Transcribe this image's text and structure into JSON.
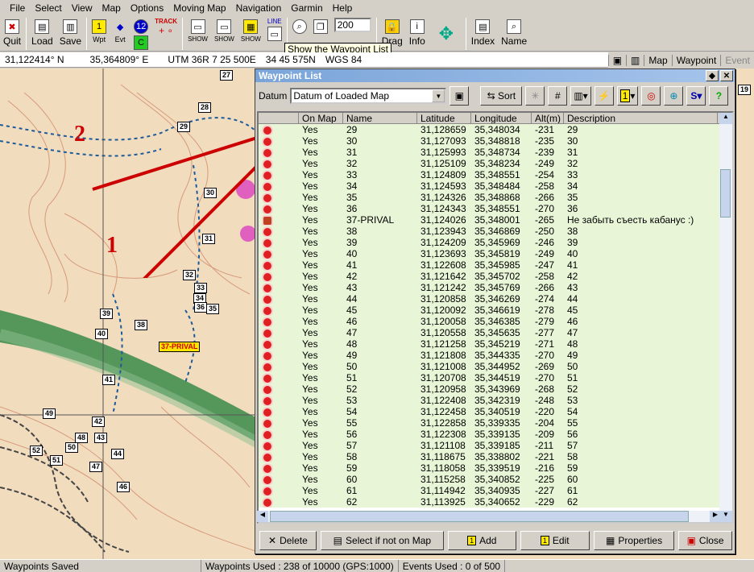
{
  "menu": [
    "File",
    "Select",
    "View",
    "Map",
    "Options",
    "Moving Map",
    "Navigation",
    "Garmin",
    "Help"
  ],
  "toolbar": {
    "quit": "Quit",
    "load": "Load",
    "save": "Save",
    "wpt": "Wpt",
    "evt": "Evt",
    "track": "TRACK",
    "line": "LINE",
    "show": "SHOW",
    "zoom_value": "200",
    "drag": "Drag",
    "info": "Info",
    "index": "Index",
    "name": "Name"
  },
  "tooltip": "Show the Waypoint List",
  "coords": {
    "lat": "31,122414° N",
    "lon": "35,364809° E",
    "utm": "UTM  36R   7 25 500E",
    "north": "34 45 575N",
    "datum": "WGS 84"
  },
  "map_tabs": [
    "Map",
    "Waypoint",
    "Event"
  ],
  "annotations": {
    "arrow1": "1",
    "arrow2": "2"
  },
  "map_labels": [
    "27",
    "28",
    "29",
    "30",
    "31",
    "32",
    "33",
    "34",
    "35",
    "36",
    "37-PRIVAL",
    "38",
    "39",
    "40",
    "41",
    "42",
    "43",
    "44",
    "46",
    "47",
    "48",
    "49",
    "50",
    "51",
    "52"
  ],
  "waypoint_list": {
    "title": "Waypoint List",
    "datum_label": "Datum",
    "datum_value": "Datum of Loaded Map",
    "sort_label": "Sort",
    "columns": [
      "On Map",
      "Name",
      "Latitude",
      "Longitude",
      "Alt(m)",
      "Description"
    ],
    "rows": [
      [
        "Yes",
        "29",
        "31,128659",
        "35,348034",
        "-231",
        "29"
      ],
      [
        "Yes",
        "30",
        "31,127093",
        "35,348818",
        "-235",
        "30"
      ],
      [
        "Yes",
        "31",
        "31,125993",
        "35,348734",
        "-239",
        "31"
      ],
      [
        "Yes",
        "32",
        "31,125109",
        "35,348234",
        "-249",
        "32"
      ],
      [
        "Yes",
        "33",
        "31,124809",
        "35,348551",
        "-254",
        "33"
      ],
      [
        "Yes",
        "34",
        "31,124593",
        "35,348484",
        "-258",
        "34"
      ],
      [
        "Yes",
        "35",
        "31,124326",
        "35,348868",
        "-266",
        "35"
      ],
      [
        "Yes",
        "36",
        "31,124343",
        "35,348551",
        "-270",
        "36"
      ],
      [
        "Yes",
        "37-PRIVAL",
        "31,124026",
        "35,348001",
        "-265",
        "Не забыть съесть кабанус :)"
      ],
      [
        "Yes",
        "38",
        "31,123943",
        "35,346869",
        "-250",
        "38"
      ],
      [
        "Yes",
        "39",
        "31,124209",
        "35,345969",
        "-246",
        "39"
      ],
      [
        "Yes",
        "40",
        "31,123693",
        "35,345819",
        "-249",
        "40"
      ],
      [
        "Yes",
        "41",
        "31,122608",
        "35,345985",
        "-247",
        "41"
      ],
      [
        "Yes",
        "42",
        "31,121642",
        "35,345702",
        "-258",
        "42"
      ],
      [
        "Yes",
        "43",
        "31,121242",
        "35,345769",
        "-266",
        "43"
      ],
      [
        "Yes",
        "44",
        "31,120858",
        "35,346269",
        "-274",
        "44"
      ],
      [
        "Yes",
        "45",
        "31,120092",
        "35,346619",
        "-278",
        "45"
      ],
      [
        "Yes",
        "46",
        "31,120058",
        "35,346385",
        "-279",
        "46"
      ],
      [
        "Yes",
        "47",
        "31,120558",
        "35,345635",
        "-277",
        "47"
      ],
      [
        "Yes",
        "48",
        "31,121258",
        "35,345219",
        "-271",
        "48"
      ],
      [
        "Yes",
        "49",
        "31,121808",
        "35,344335",
        "-270",
        "49"
      ],
      [
        "Yes",
        "50",
        "31,121008",
        "35,344952",
        "-269",
        "50"
      ],
      [
        "Yes",
        "51",
        "31,120708",
        "35,344519",
        "-270",
        "51"
      ],
      [
        "Yes",
        "52",
        "31,120958",
        "35,343969",
        "-268",
        "52"
      ],
      [
        "Yes",
        "53",
        "31,122408",
        "35,342319",
        "-248",
        "53"
      ],
      [
        "Yes",
        "54",
        "31,122458",
        "35,340519",
        "-220",
        "54"
      ],
      [
        "Yes",
        "55",
        "31,122858",
        "35,339335",
        "-204",
        "55"
      ],
      [
        "Yes",
        "56",
        "31,122308",
        "35,339135",
        "-209",
        "56"
      ],
      [
        "Yes",
        "57",
        "31,121108",
        "35,339185",
        "-211",
        "57"
      ],
      [
        "Yes",
        "58",
        "31,118675",
        "35,338802",
        "-221",
        "58"
      ],
      [
        "Yes",
        "59",
        "31,118058",
        "35,339519",
        "-216",
        "59"
      ],
      [
        "Yes",
        "60",
        "31,115258",
        "35,340852",
        "-225",
        "60"
      ],
      [
        "Yes",
        "61",
        "31,114942",
        "35,340935",
        "-227",
        "61"
      ],
      [
        "Yes",
        "62",
        "31,113925",
        "35,340652",
        "-229",
        "62"
      ]
    ],
    "buttons": {
      "delete": "Delete",
      "select_not_on_map": "Select if not on Map",
      "add": "Add",
      "edit": "Edit",
      "properties": "Properties",
      "close": "Close"
    }
  },
  "status": {
    "left": "Waypoints Saved",
    "used": "Waypoints Used : 238 of 10000  (GPS:1000)",
    "events": "Events Used : 0 of 500"
  }
}
